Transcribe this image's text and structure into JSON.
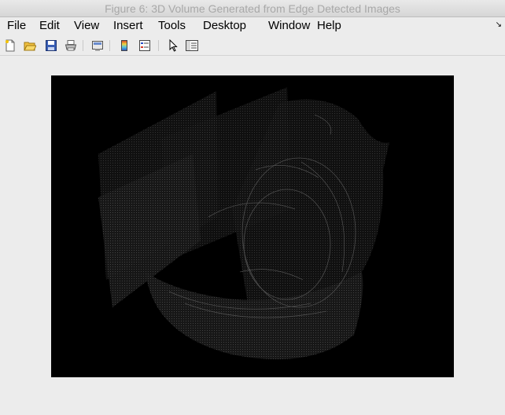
{
  "window": {
    "title": "Figure 6: 3D Volume Generated from Edge Detected Images"
  },
  "menu": {
    "items": [
      {
        "label": "File"
      },
      {
        "label": "Edit"
      },
      {
        "label": "View"
      },
      {
        "label": "Insert"
      },
      {
        "label": "Tools"
      },
      {
        "label": "Desktop"
      },
      {
        "label": "Window"
      },
      {
        "label": "Help"
      }
    ],
    "overflow_icon": "overflow-arrow-icon"
  },
  "toolbar": {
    "tools": [
      {
        "name": "new-figure-icon"
      },
      {
        "name": "open-file-icon"
      },
      {
        "name": "save-icon"
      },
      {
        "name": "print-icon"
      },
      {
        "name": "link-plot-icon"
      },
      {
        "name": "colorbar-icon"
      },
      {
        "name": "legend-icon"
      },
      {
        "name": "pointer-icon"
      },
      {
        "name": "property-editor-icon"
      }
    ]
  },
  "figure": {
    "background_color": "#000000",
    "content": "3D volume rendering of edge-detected image slices"
  }
}
